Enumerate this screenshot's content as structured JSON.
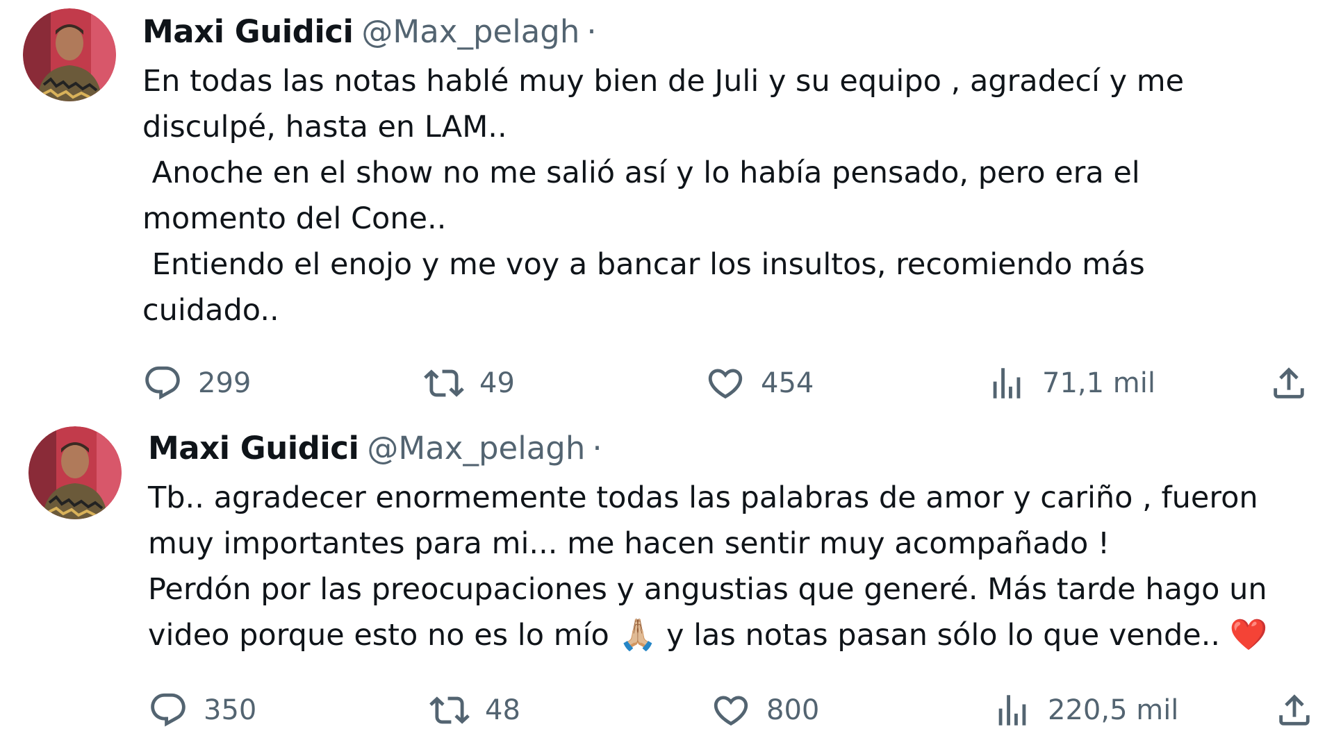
{
  "tweets": [
    {
      "author": {
        "name": "Maxi Guidici",
        "handle": "@Max_pelagh",
        "separator": "·"
      },
      "text_lines": [
        "En todas las notas hablé muy bien de Juli y su equipo , agradecí y me",
        "disculpé, hasta en LAM..",
        " Anoche en el show no me salió así y lo había pensado, pero era el",
        "momento del Cone..",
        " Entiendo el enojo y me voy a bancar los insultos, recomiendo más",
        "cuidado.."
      ],
      "stats": {
        "replies": "299",
        "retweets": "49",
        "likes": "454",
        "views": "71,1 mil"
      }
    },
    {
      "author": {
        "name": "Maxi Guidici",
        "handle": "@Max_pelagh",
        "separator": "·"
      },
      "text_lines": [
        "Tb.. agradecer enormemente todas las palabras de amor y cariño , fueron",
        "muy importantes para mi... me hacen sentir muy acompañado !",
        "Perdón por las preocupaciones y angustias que generé. Más tarde hago un",
        "video porque esto no es lo mío "
      ],
      "emoji_pray": "🙏🏼",
      "text_after_emoji": " y las notas pasan sólo lo que vende.. ",
      "emoji_heart": "❤️",
      "stats": {
        "replies": "350",
        "retweets": "48",
        "likes": "800",
        "views": "220,5 mil"
      }
    }
  ],
  "icons": {
    "reply": "reply-icon",
    "retweet": "retweet-icon",
    "like": "heart-icon",
    "views": "views-icon",
    "share": "share-icon"
  },
  "colors": {
    "text": "#0f1419",
    "secondary": "#536471",
    "avatar_bg": "#c23b4b"
  }
}
